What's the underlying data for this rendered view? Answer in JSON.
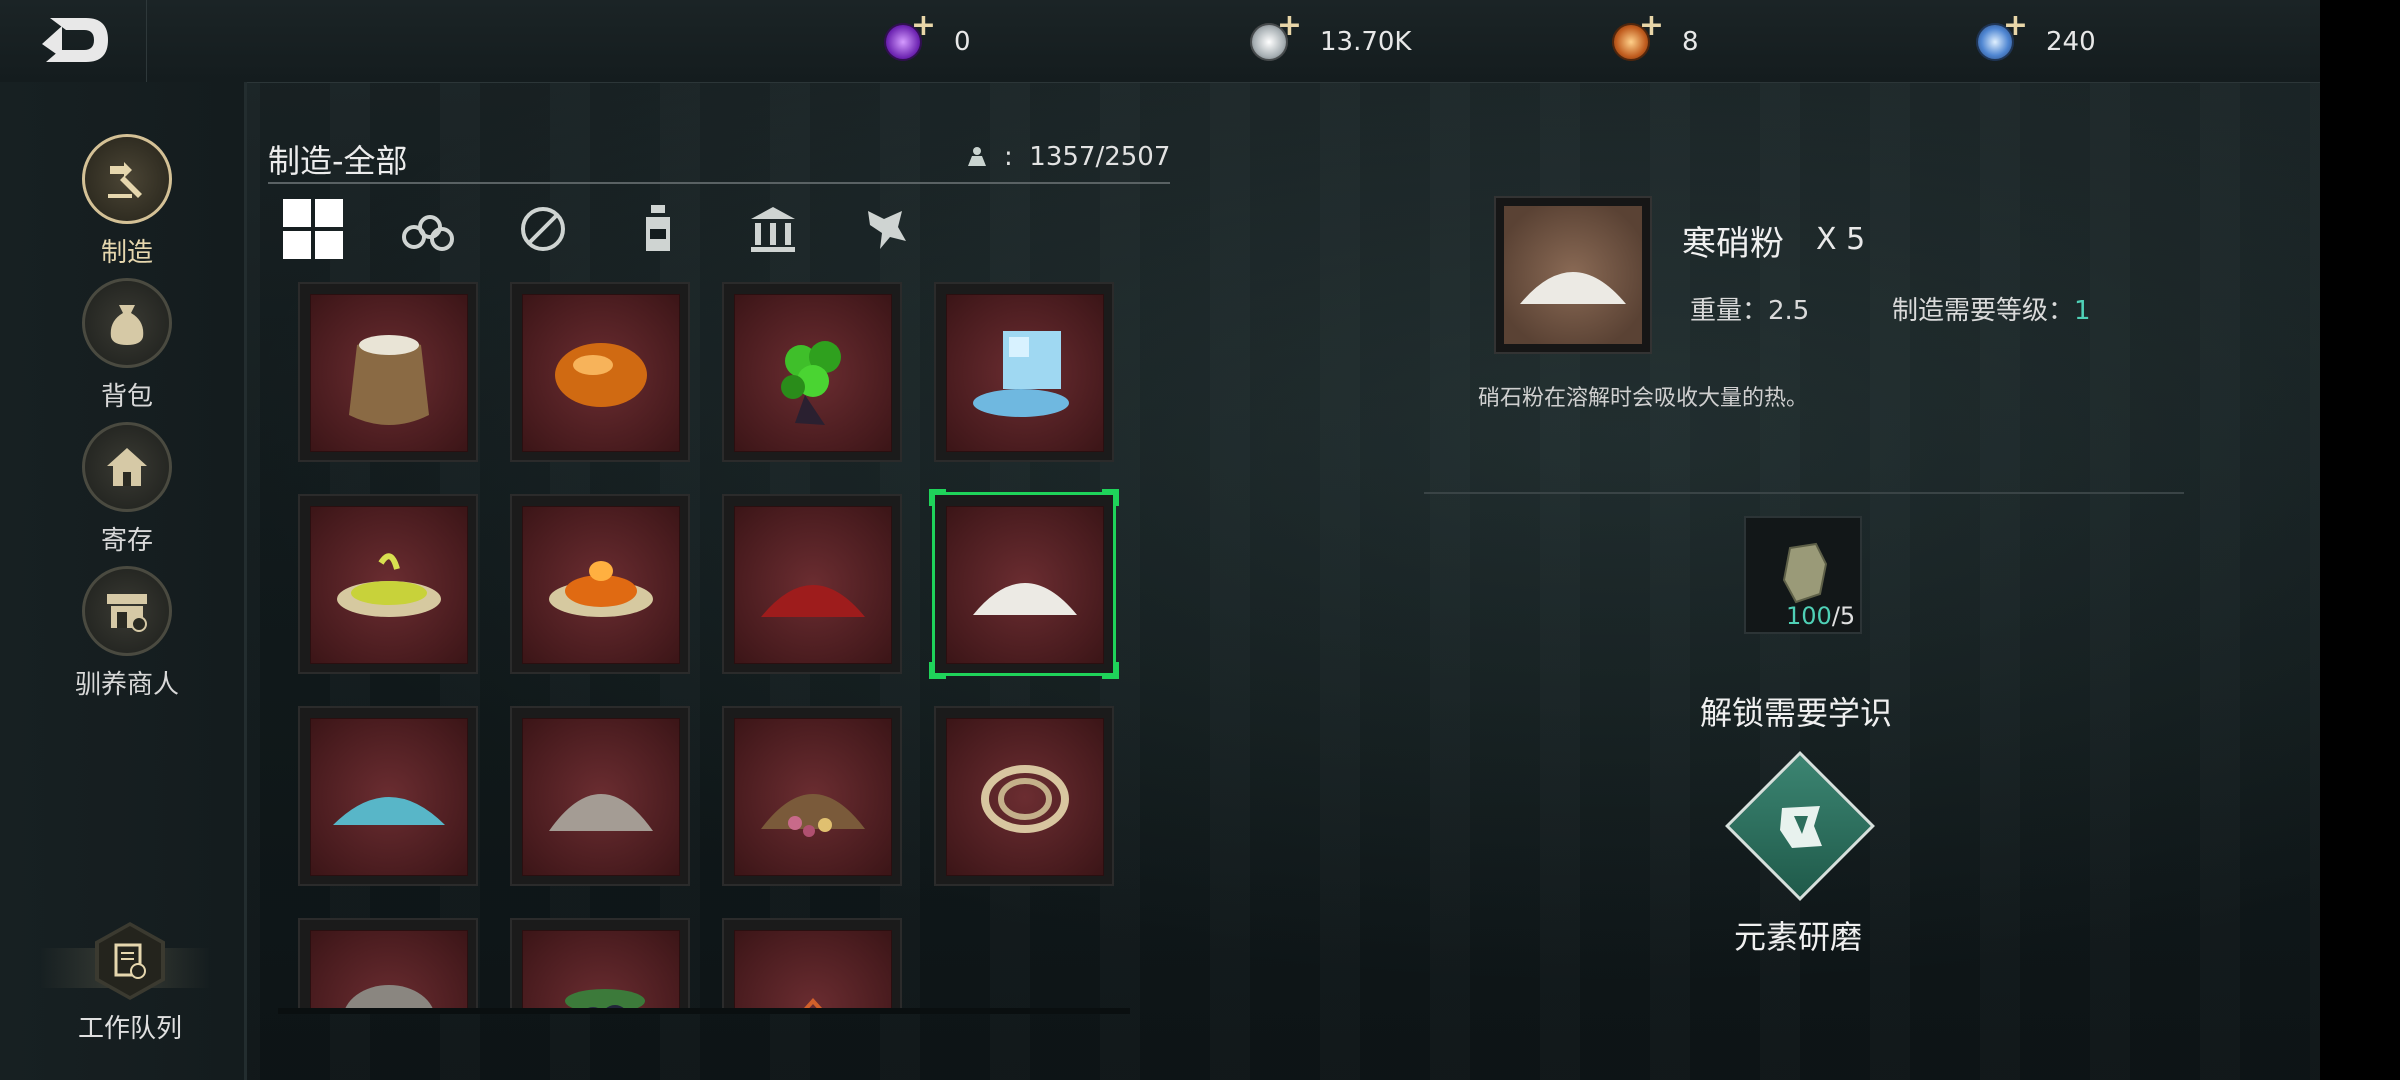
{
  "currencies": [
    {
      "name": "purple-gem",
      "value": "0",
      "color": "#8a3fd0"
    },
    {
      "name": "silver-coin",
      "value": "13.70K",
      "color": "#b8c0c4"
    },
    {
      "name": "amber-coin",
      "value": "8",
      "color": "#d2782a"
    },
    {
      "name": "blue-gem",
      "value": "240",
      "color": "#5a8fd6"
    }
  ],
  "sidebar": {
    "items": [
      {
        "label": "制造",
        "icon": "craft-hammer-icon",
        "active": true
      },
      {
        "label": "背包",
        "icon": "bag-icon"
      },
      {
        "label": "寄存",
        "icon": "storage-house-icon"
      },
      {
        "label": "驯养商人",
        "icon": "merchant-shop-icon"
      }
    ],
    "queue_label": "工作队列"
  },
  "craft": {
    "title": "制造-全部",
    "weight": "1357/2507",
    "tabs": [
      {
        "icon": "grid-all-icon",
        "active": true
      },
      {
        "icon": "wood-logs-icon"
      },
      {
        "icon": "tools-disabled-icon"
      },
      {
        "icon": "bottle-icon"
      },
      {
        "icon": "building-icon"
      },
      {
        "icon": "pet-icon"
      }
    ],
    "items": [
      {
        "icon": "flour-sack-icon"
      },
      {
        "icon": "amber-resin-icon"
      },
      {
        "icon": "green-berries-icon"
      },
      {
        "icon": "ice-cube-icon"
      },
      {
        "icon": "green-paste-dish-icon"
      },
      {
        "icon": "orange-paste-dish-icon"
      },
      {
        "icon": "red-powder-icon"
      },
      {
        "icon": "white-powder-icon",
        "selected": true
      },
      {
        "icon": "blue-powder-icon"
      },
      {
        "icon": "gray-powder-icon"
      },
      {
        "icon": "seed-mix-icon"
      },
      {
        "icon": "rope-coil-icon"
      },
      {
        "icon": "stone-icon"
      },
      {
        "icon": "dark-berries-icon"
      },
      {
        "icon": "ember-icon"
      }
    ]
  },
  "detail": {
    "name": "寒硝粉",
    "quantity": "X 5",
    "weight_label": "重量：2.5",
    "level_label": "制造需要等级：",
    "level": "1",
    "description": "硝石粉在溶解时会吸收大量的热。",
    "material": {
      "icon": "ore-stone-icon",
      "have": "100",
      "need": "/5"
    },
    "unlock_title": "解锁需要学识",
    "knowledge": {
      "icon": "element-grind-icon",
      "label": "元素研磨"
    }
  }
}
